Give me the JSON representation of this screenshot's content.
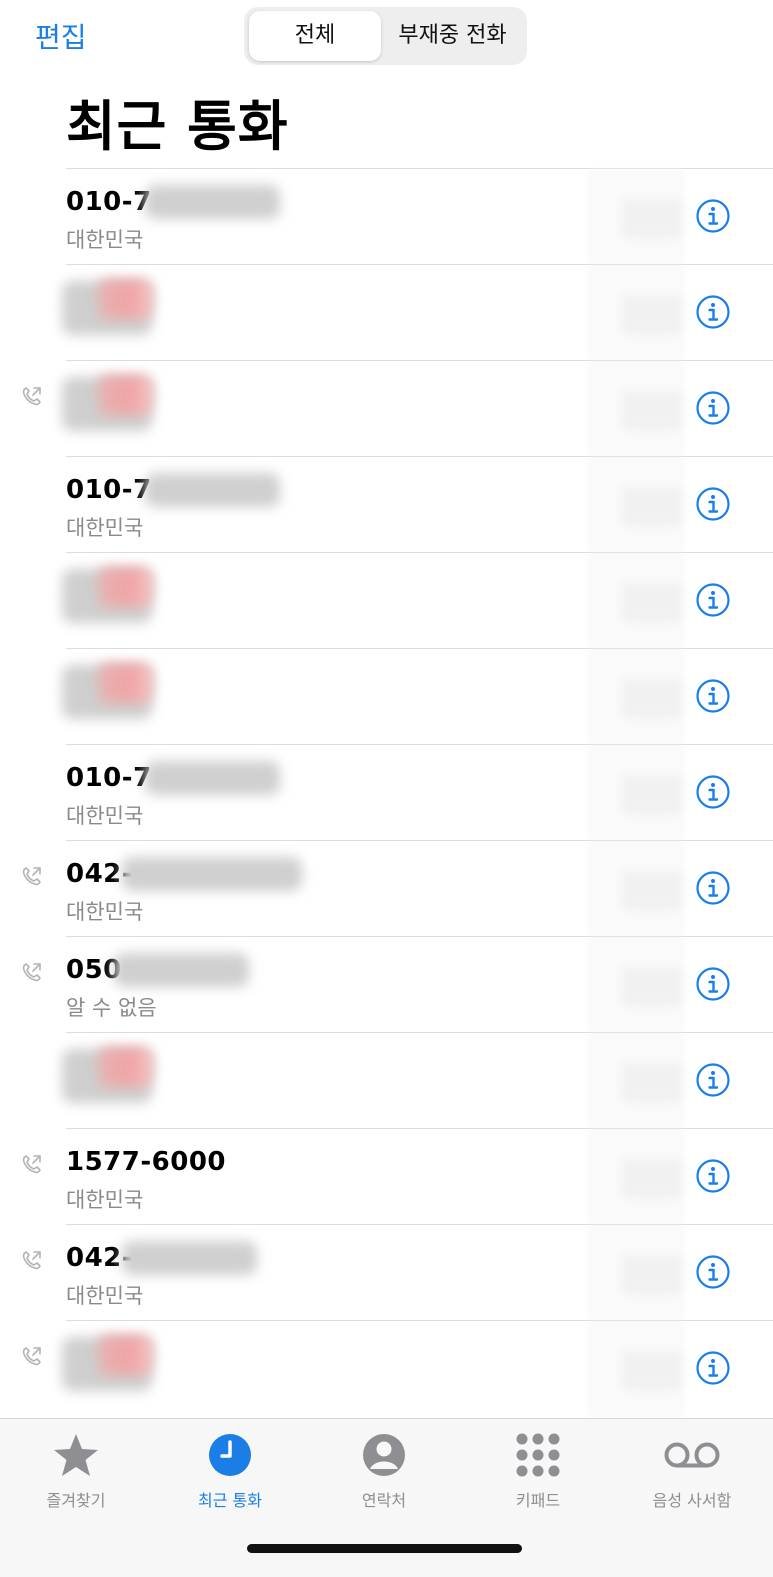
{
  "header": {
    "edit_label": "편집",
    "segments": [
      "전체",
      "부재중 전화"
    ],
    "selected_segment": "전체",
    "title": "최근 통화"
  },
  "calls": [
    {
      "primary": "010-7",
      "secondary": "대한민국",
      "outgoing_icon": false,
      "blurred": "number"
    },
    {
      "primary": "",
      "secondary": "",
      "outgoing_icon": false,
      "blurred": "name"
    },
    {
      "primary": "",
      "secondary": "",
      "outgoing_icon": true,
      "blurred": "name"
    },
    {
      "primary": "010-7",
      "secondary": "대한민국",
      "outgoing_icon": false,
      "blurred": "number"
    },
    {
      "primary": "",
      "secondary": "",
      "outgoing_icon": false,
      "blurred": "name"
    },
    {
      "primary": "",
      "secondary": "",
      "outgoing_icon": false,
      "blurred": "name"
    },
    {
      "primary": "010-7",
      "secondary": "대한민국",
      "outgoing_icon": false,
      "blurred": "number"
    },
    {
      "primary": "042-",
      "secondary": "대한민국",
      "outgoing_icon": true,
      "blurred": "number"
    },
    {
      "primary": "050",
      "secondary": "알 수 없음",
      "outgoing_icon": true,
      "blurred": "number"
    },
    {
      "primary": "",
      "secondary": "",
      "outgoing_icon": false,
      "blurred": "name"
    },
    {
      "primary": "1577-6000",
      "secondary": "대한민국",
      "outgoing_icon": true,
      "blurred": "none"
    },
    {
      "primary": "042-",
      "secondary": "대한민국",
      "outgoing_icon": true,
      "blurred": "number"
    },
    {
      "primary": "",
      "secondary": "",
      "outgoing_icon": true,
      "blurred": "name"
    }
  ],
  "tabbar": {
    "items": [
      {
        "label": "즐겨찾기",
        "icon": "star-icon"
      },
      {
        "label": "최근 통화",
        "icon": "clock-icon",
        "active": true
      },
      {
        "label": "연락처",
        "icon": "person-circle-icon"
      },
      {
        "label": "키패드",
        "icon": "keypad-icon"
      },
      {
        "label": "음성 사서함",
        "icon": "voicemail-icon"
      }
    ]
  },
  "colors": {
    "accent": "#1a7ee6",
    "secondary_text": "#8a8a8e"
  }
}
